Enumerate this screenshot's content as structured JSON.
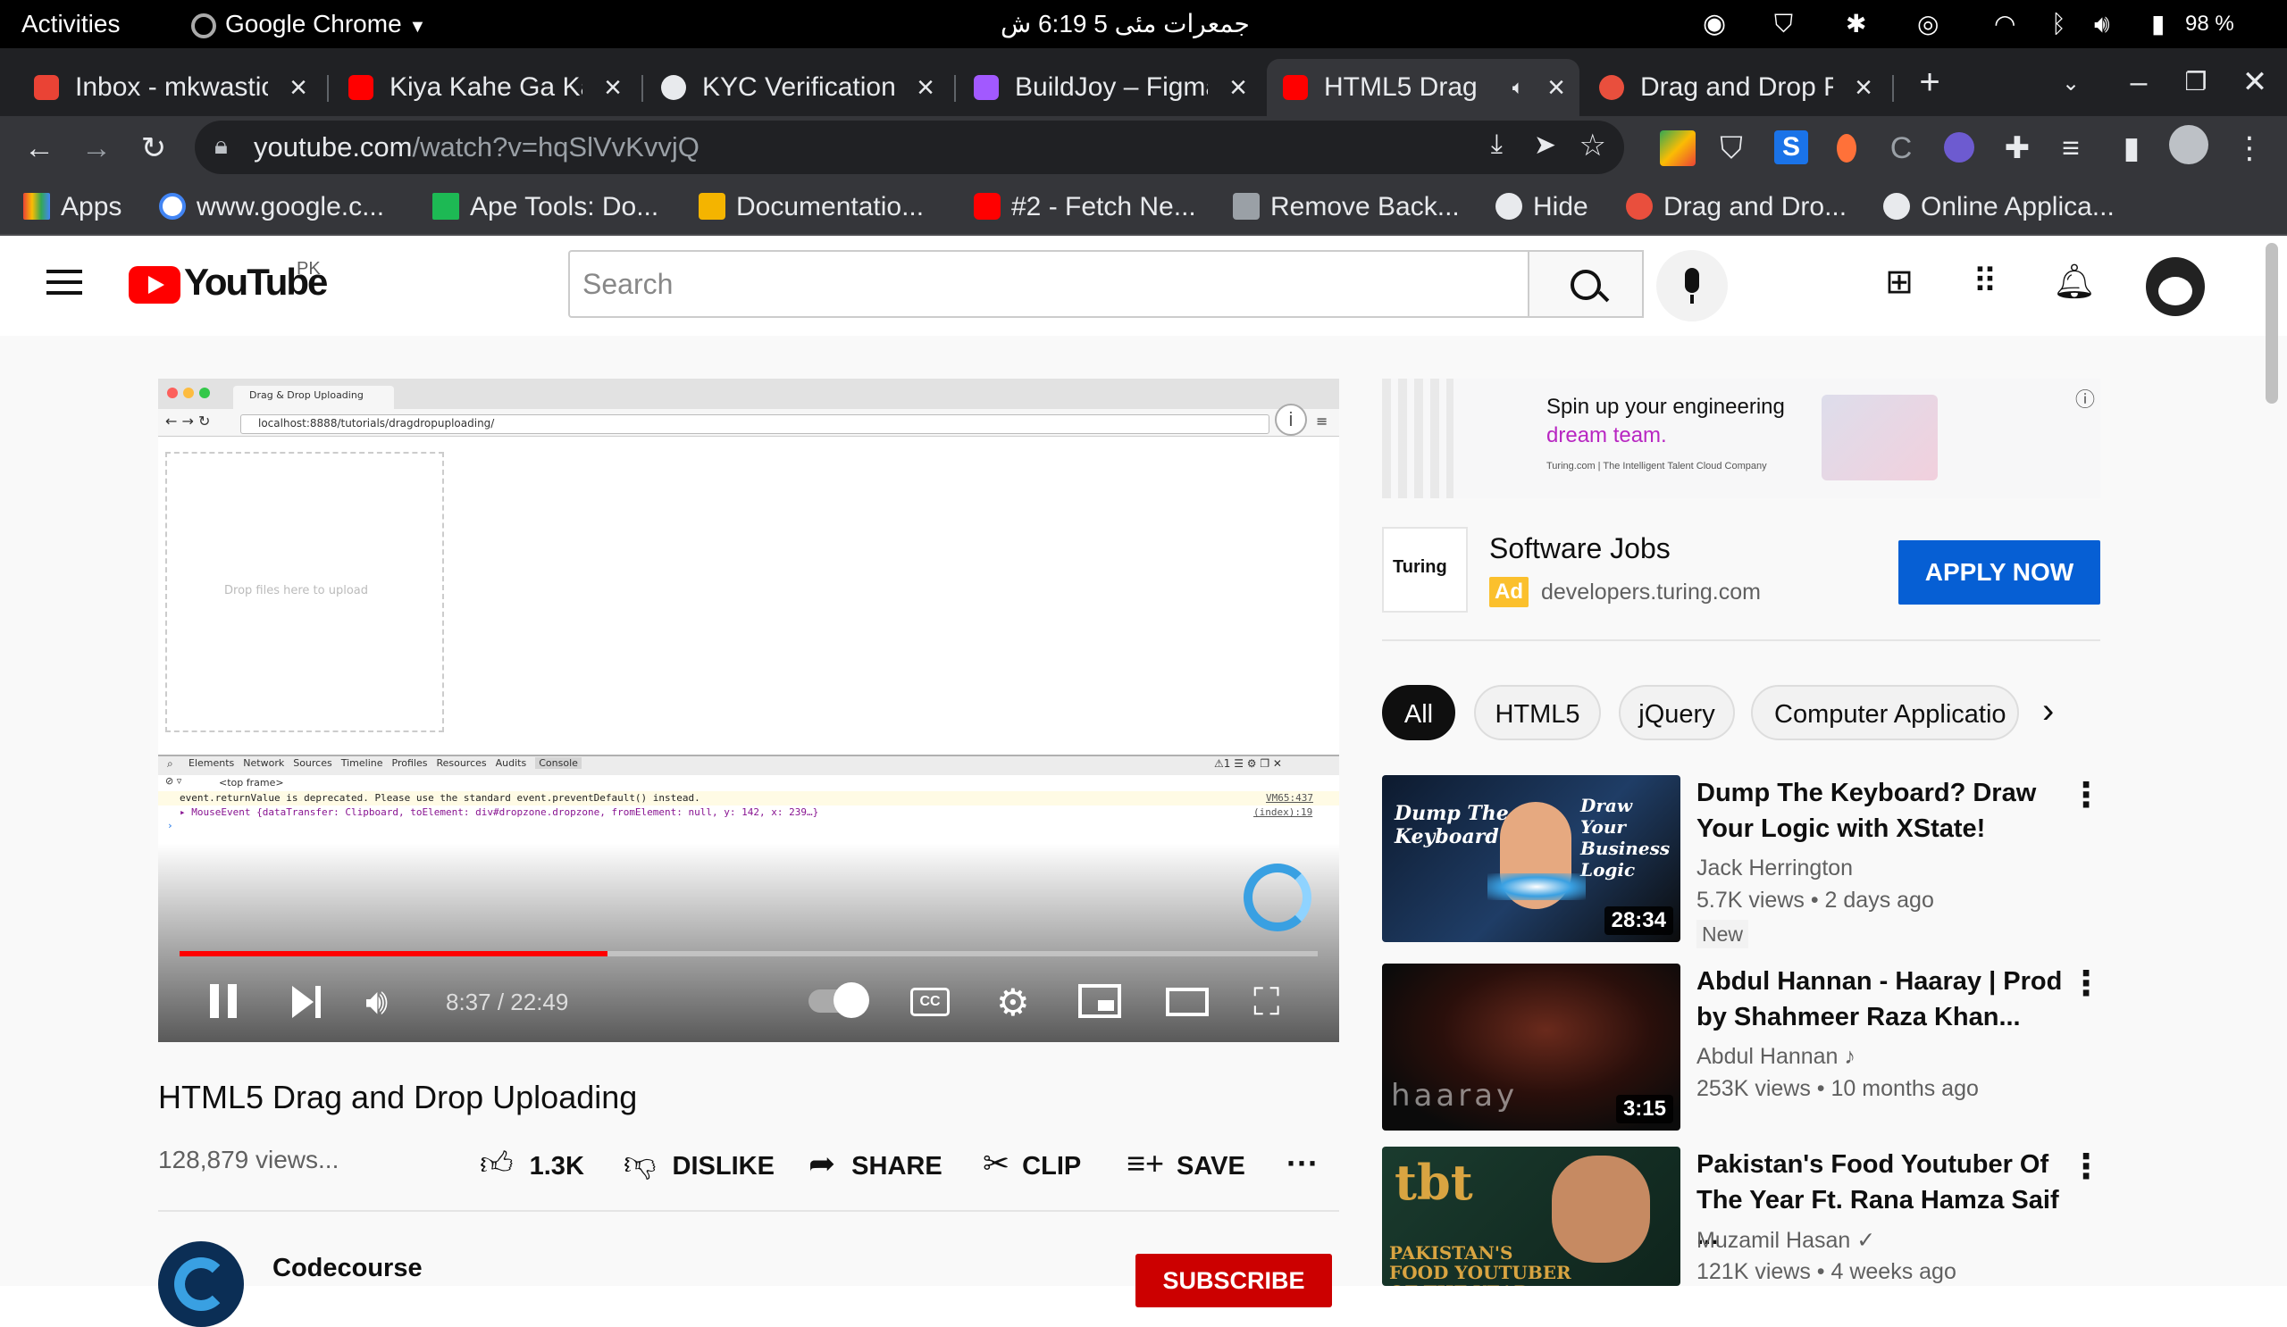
{
  "system": {
    "activities": "Activities",
    "app_name": "Google Chrome",
    "datetime": "جمعرات مئی 5  6:19 ش",
    "battery": "98 %"
  },
  "tabs": [
    {
      "label": "Inbox - mkwastic",
      "favicon_color": "#ea4335"
    },
    {
      "label": "Kiya Kahe Ga Ka",
      "favicon_color": "#ff0000"
    },
    {
      "label": "KYC Verification",
      "favicon_color": "#e8eaed"
    },
    {
      "label": "BuildJoy – Figma",
      "favicon_color": "#a259ff"
    },
    {
      "label": "HTML5 Drag",
      "favicon_color": "#ff0000"
    },
    {
      "label": "Drag and Drop F",
      "favicon_color": "#e94f3d"
    }
  ],
  "address": {
    "host": "youtube.com",
    "path": "/watch?v=hqSlVvKvvjQ"
  },
  "bookmarks": [
    {
      "label": "Apps",
      "icon": "grid-icon"
    },
    {
      "label": "www.google.c...",
      "icon": "google-icon"
    },
    {
      "label": "Ape Tools: Do...",
      "icon": "v-icon"
    },
    {
      "label": "Documentatio...",
      "icon": "doc-icon"
    },
    {
      "label": "#2 - Fetch Ne...",
      "icon": "youtube-icon"
    },
    {
      "label": "Remove Back...",
      "icon": "layers-icon"
    },
    {
      "label": "Hide",
      "icon": "globe-icon"
    },
    {
      "label": "Drag and Dro...",
      "icon": "asterisk-icon"
    },
    {
      "label": "Online Applica...",
      "icon": "globe-icon"
    }
  ],
  "youtube": {
    "logo_text": "YouTube",
    "region": "PK",
    "search_placeholder": "Search"
  },
  "video": {
    "inner_tab": "Drag & Drop Uploading",
    "inner_url": "localhost:8888/tutorials/dragdropuploading/",
    "dropzone_text": "Drop files here to upload",
    "devtools_tabs": [
      "Elements",
      "Network",
      "Sources",
      "Timeline",
      "Profiles",
      "Resources",
      "Audits",
      "Console"
    ],
    "frame": "<top frame>",
    "console_line1": "event.returnValue is deprecated. Please use the standard event.preventDefault() instead.",
    "console_line1_src": "VM65:437",
    "console_line2": "▸ MouseEvent {dataTransfer: Clipboard, toElement: div#dropzone.dropzone, fromElement: null, y: 142, x: 239…}",
    "console_line2_src": "(index):19",
    "time": "8:37 / 22:49",
    "progress": 0.376,
    "title": "HTML5 Drag and Drop Uploading",
    "views": "128,879 views...",
    "likes": "1.3K",
    "dislike": "DISLIKE",
    "share": "SHARE",
    "clip": "CLIP",
    "save": "SAVE",
    "channel": "Codecourse",
    "subscribe": "SUBSCRIBE"
  },
  "ad": {
    "banner_line1": "Spin up your engineering",
    "banner_line2": "dream team.",
    "banner_footer": "Turing.com  |  The Intelligent Talent Cloud Company",
    "logo_text": "Turing",
    "title": "Software Jobs",
    "badge": "Ad",
    "domain": "developers.turing.com",
    "cta": "APPLY NOW"
  },
  "chips": [
    "All",
    "HTML5",
    "jQuery",
    "Computer Applicatio"
  ],
  "related": [
    {
      "title": "Dump The Keyboard? Draw Your Logic with XState!",
      "channel": "Jack Herrington",
      "meta": "5.7K views • 2 days ago",
      "badge": "New",
      "duration": "28:34",
      "thumb_left": "Dump The Keyboard",
      "thumb_right": "Draw Your Business Logic"
    },
    {
      "title": "Abdul Hannan - Haaray | Prod by Shahmeer Raza Khan...",
      "channel": "Abdul Hannan ♪",
      "meta": "253K views • 10 months ago",
      "duration": "3:15",
      "thumb_text": "haaray"
    },
    {
      "title": "Pakistan's Food Youtuber Of The Year Ft. Rana Hamza Saif ...",
      "channel": "Muzamil Hasan ✓",
      "meta": "121K views • 4 weeks ago",
      "thumb_text": "tbt",
      "thumb_caption": "PAKISTAN'S FOOD YOUTUBER OF THE YEAR"
    }
  ]
}
